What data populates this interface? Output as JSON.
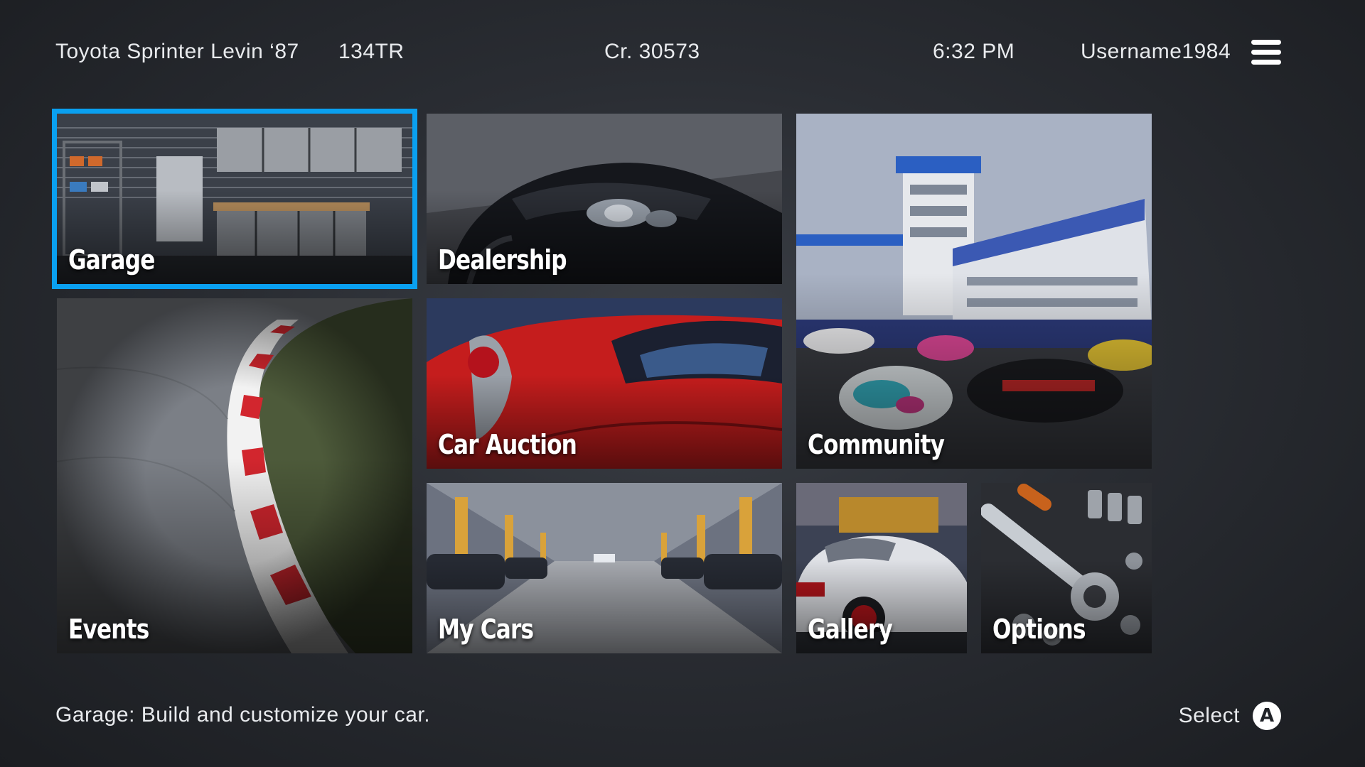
{
  "header": {
    "car_name": "Toyota Sprinter Levin ‘87",
    "car_pp": "134TR",
    "credits": "Cr. 30573",
    "clock": "6:32 PM",
    "username": "Username1984",
    "menu_icon": "hamburger-menu-icon"
  },
  "tiles": [
    {
      "id": "garage",
      "label": "Garage",
      "selected": true
    },
    {
      "id": "dealership",
      "label": "Dealership",
      "selected": false
    },
    {
      "id": "community",
      "label": "Community",
      "selected": false
    },
    {
      "id": "events",
      "label": "Events",
      "selected": false
    },
    {
      "id": "car_auction",
      "label": "Car Auction",
      "selected": false
    },
    {
      "id": "my_cars",
      "label": "My Cars",
      "selected": false
    },
    {
      "id": "gallery",
      "label": "Gallery",
      "selected": false
    },
    {
      "id": "options",
      "label": "Options",
      "selected": false
    }
  ],
  "footer": {
    "hint": "Garage: Build and customize your car.",
    "select_label": "Select",
    "select_button_glyph": "A"
  },
  "colors": {
    "selection_outline": "#0aa0f0",
    "background": "#2a2d33"
  }
}
